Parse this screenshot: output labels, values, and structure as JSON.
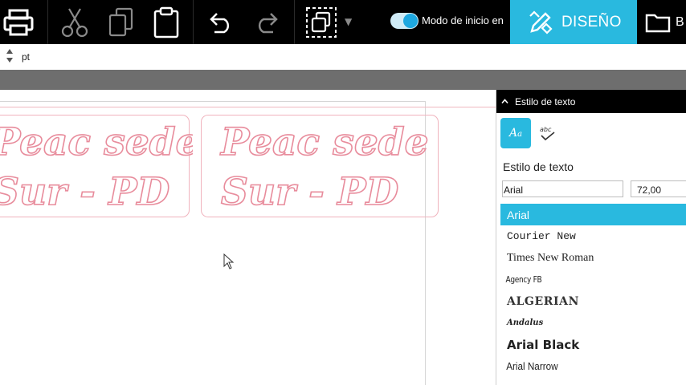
{
  "toolbar": {
    "buttons": [
      "printer-icon",
      "scissors-icon",
      "copy-icon",
      "clipboard-icon",
      "undo-icon",
      "redo-icon",
      "select-group-icon"
    ],
    "toggle_label": "Modo de inicio en",
    "toggle_on": true,
    "design_tab_label": "DISEÑO",
    "library_tab_label": "B",
    "accent": "#29b9df"
  },
  "subbar": {
    "unit": "pt"
  },
  "canvas": {
    "labels": [
      {
        "line1": "Peac sede",
        "line2": "Sur - PD"
      },
      {
        "line1": "Peac sede",
        "line2": "Sur - PD"
      }
    ],
    "outline_color": "#e88c9c"
  },
  "panel": {
    "header": "Estilo de texto",
    "section_title": "Estilo de texto",
    "font_value": "Arial",
    "size_value": "72,00",
    "fonts": [
      "Arial",
      "Courier New",
      "Times New Roman",
      "Agency FB",
      "ALGERIAN",
      "Andalus",
      "Arial Black",
      "Arial Narrow"
    ]
  }
}
